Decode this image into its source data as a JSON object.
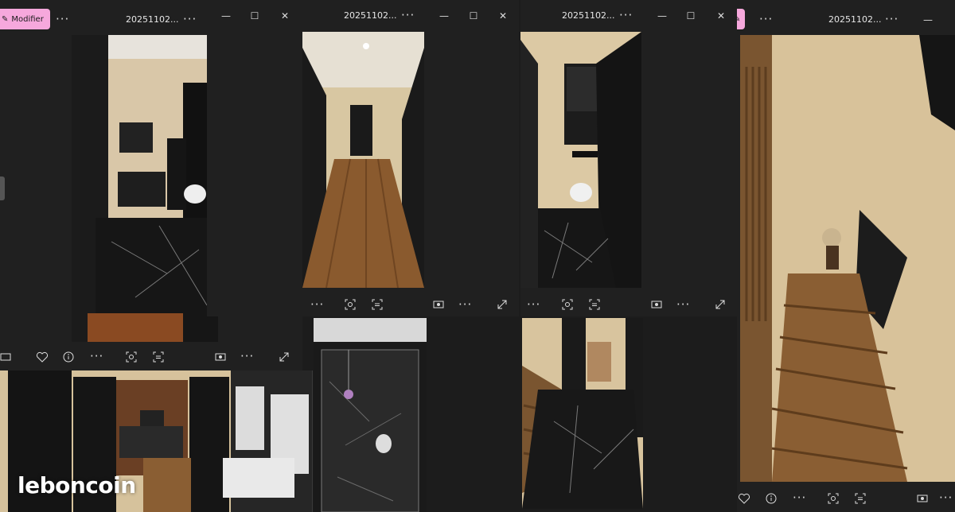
{
  "windows": [
    {
      "title": "20251102..."
    },
    {
      "title": "20251102..."
    },
    {
      "title": "20251102..."
    },
    {
      "title": "20251102..."
    }
  ],
  "modify_label": "Modifier",
  "more_glyph": "···",
  "window_controls": {
    "minimize": "—",
    "maximize": "☐",
    "close": "✕"
  },
  "watermark": "leboncoin",
  "colors": {
    "accent_pink": "#f6a8dc",
    "window_bg": "#202020"
  }
}
